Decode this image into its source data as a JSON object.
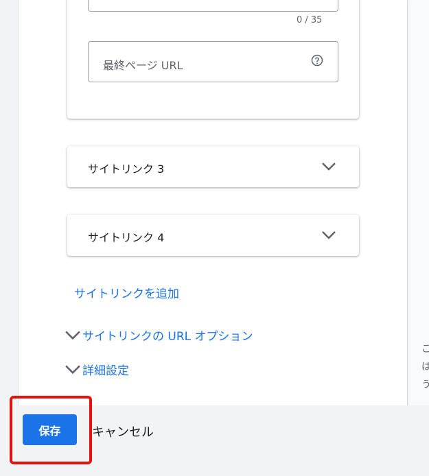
{
  "sitelink2": {
    "char_counter": "0 / 35",
    "final_url_placeholder": "最終ページ URL"
  },
  "sitelinks": [
    {
      "title": "サイトリンク 3"
    },
    {
      "title": "サイトリンク 4"
    }
  ],
  "add_sitelink_label": "サイトリンクを追加",
  "url_options_label": "サイトリンクの URL オプション",
  "advanced_settings_label": "詳細設定",
  "side_text": "こ\nは\nう",
  "footer": {
    "save_label": "保存",
    "cancel_label": "キャンセル"
  },
  "colors": {
    "accent": "#1a73e8",
    "highlight": "#e3120b"
  }
}
